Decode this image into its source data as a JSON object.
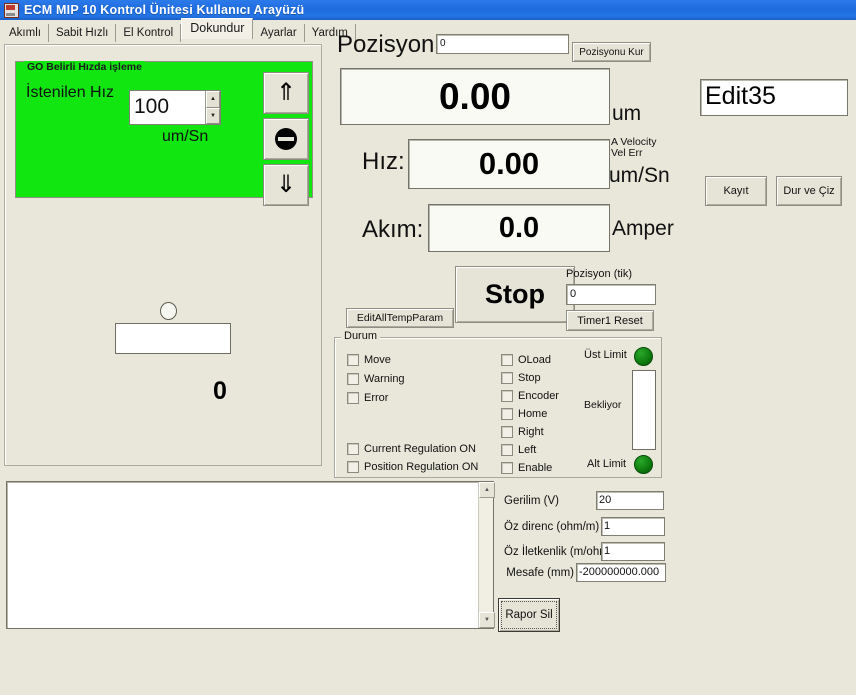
{
  "window": {
    "title": "ECM MIP 10 Kontrol Ünitesi Kullanıcı Arayüzü",
    "icon": "app-icon"
  },
  "tabs": [
    {
      "label": "Akımlı",
      "active": false
    },
    {
      "label": "Sabit Hızlı",
      "active": false
    },
    {
      "label": "El Kontrol",
      "active": false
    },
    {
      "label": "Dokundur",
      "active": true
    },
    {
      "label": "Ayarlar",
      "active": false
    },
    {
      "label": "Yardım",
      "active": false
    }
  ],
  "speed_group": {
    "legend": "GO Belirli Hızda işleme",
    "label": "İstenilen Hız",
    "value": "100",
    "unit": "um/Sn",
    "buttons": [
      {
        "name": "up-arrow-button",
        "glyph": "⇑"
      },
      {
        "name": "no-entry-button",
        "glyph": "⛔"
      },
      {
        "name": "down-arrow-button",
        "glyph": "⇓"
      }
    ]
  },
  "left_extra": {
    "zero_label": "0"
  },
  "position": {
    "label": "Pozisyon:",
    "input_value": "0",
    "set_button": "Pozisyonu Kur",
    "display": "0.00",
    "unit": "um"
  },
  "speed": {
    "label": "Hız:",
    "display": "0.00",
    "unit": "um/Sn",
    "sub1": "A Velocity",
    "sub2": "Vel Err"
  },
  "current": {
    "label": "Akım:",
    "display": "0.0",
    "unit": "Amper"
  },
  "edit_field": {
    "value": "Edit35"
  },
  "side_buttons": {
    "save": "Kayıt",
    "stop_draw": "Dur ve Çiz"
  },
  "stop_area": {
    "stop_label": "Stop",
    "edit_all_temp": "EditAllTempParam",
    "tick_label": "Pozisyon (tik)",
    "tick_value": "0",
    "timer_reset": "Timer1 Reset"
  },
  "status": {
    "legend": "Durum",
    "col1": [
      "Move",
      "Warning",
      "Error"
    ],
    "col1b": [
      "Current Regulation ON",
      "Position Regulation ON"
    ],
    "col2": [
      "OLoad",
      "Stop",
      "Encoder",
      "Home",
      "Right",
      "Left",
      "Enable"
    ],
    "upper_limit": "Üst Limit",
    "lower_limit": "Alt Limit",
    "waiting": "Bekliyor",
    "led_color": "#0D7A0D"
  },
  "report": {
    "text": ""
  },
  "params": {
    "rows": [
      {
        "label": "Gerilim (V)",
        "value": "20"
      },
      {
        "label": "Öz direnc (ohm/m)",
        "value": "1"
      },
      {
        "label": "Öz İletkenlik (m/ohm)",
        "value": "1"
      },
      {
        "label": "Mesafe (mm)",
        "value": "-200000000.000"
      }
    ],
    "clear_button": "Rapor Sil"
  },
  "colors": {
    "titlebar": "#2375E5",
    "background": "#E9E7DA",
    "green_panel": "#11E611",
    "led_green": "#0D7A0D"
  }
}
